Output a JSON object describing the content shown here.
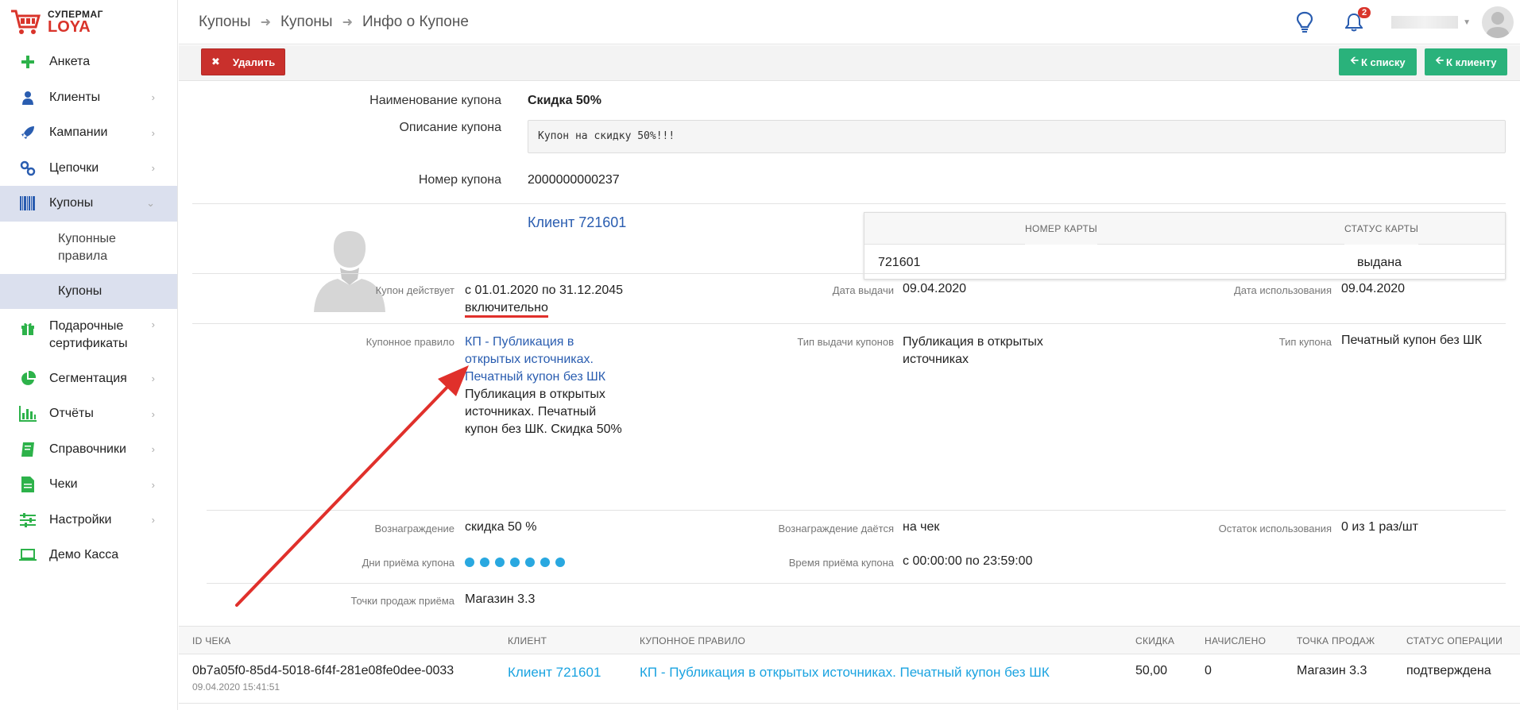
{
  "logo": {
    "top": "СУПЕРМАГ",
    "bottom": "LOYA"
  },
  "sidebar": {
    "items": [
      {
        "label": "Анкета",
        "icon": "plus-icon",
        "chevron": false
      },
      {
        "label": "Клиенты",
        "icon": "user-icon",
        "chevron": true
      },
      {
        "label": "Кампании",
        "icon": "rocket-icon",
        "chevron": true
      },
      {
        "label": "Цепочки",
        "icon": "chain-icon",
        "chevron": true
      },
      {
        "label": "Купоны",
        "icon": "barcode-icon",
        "chevron": true,
        "active": true
      },
      {
        "label": "Подарочные сертификаты",
        "icon": "gift-icon",
        "chevron": true
      },
      {
        "label": "Сегментация",
        "icon": "pie-icon",
        "chevron": true
      },
      {
        "label": "Отчёты",
        "icon": "bar-chart-icon",
        "chevron": true
      },
      {
        "label": "Справочники",
        "icon": "book-icon",
        "chevron": true
      },
      {
        "label": "Чеки",
        "icon": "receipt-icon",
        "chevron": true
      },
      {
        "label": "Настройки",
        "icon": "sliders-icon",
        "chevron": true
      },
      {
        "label": "Демо Касса",
        "icon": "laptop-icon",
        "chevron": false
      }
    ],
    "sub_items": [
      {
        "label": "Купонные правила"
      },
      {
        "label": "Купоны",
        "active": true
      }
    ]
  },
  "header": {
    "breadcrumb": [
      "Купоны",
      "Купоны",
      "Инфо о Купоне"
    ],
    "notifications_count": "2"
  },
  "toolbar": {
    "delete_label": "Удалить",
    "to_list_label": "К списку",
    "to_client_label": "К клиенту"
  },
  "coupon": {
    "name_label": "Наименование купона",
    "name_value": "Скидка 50%",
    "desc_label": "Описание купона",
    "desc_value": "Купон на скидку 50%!!!",
    "number_label": "Номер купона",
    "number_value": "2000000000237"
  },
  "client": {
    "link": "Клиент 721601",
    "cards_table": {
      "headers": [
        "НОМЕР КАРТЫ",
        "СТАТУС КАРТЫ"
      ],
      "rows": [
        [
          "721601",
          "выдана"
        ]
      ]
    }
  },
  "details": {
    "valid_label": "Купон действует",
    "valid_value_line1": "с 01.01.2020 по 31.12.2045",
    "valid_value_line2": "включительно",
    "issue_date_label": "Дата выдачи",
    "issue_date_value": "09.04.2020",
    "use_date_label": "Дата использования",
    "use_date_value": "09.04.2020",
    "rule_label": "Купонное правило",
    "rule_link_lines": [
      "КП - Публикация в",
      "открытых источниках.",
      "Печатный купон без ШК"
    ],
    "rule_desc_lines": [
      "Публикация в открытых",
      "источниках. Печатный",
      "купон без ШК. Скидка 50%"
    ],
    "issue_type_label": "Тип выдачи купонов",
    "issue_type_lines": [
      "Публикация в открытых",
      "источниках"
    ],
    "coupon_type_label": "Тип купона",
    "coupon_type_value": "Печатный купон без ШК",
    "reward_label": "Вознаграждение",
    "reward_value": "скидка 50 %",
    "reward_given_label": "Вознаграждение даётся",
    "reward_given_value": "на чек",
    "usage_left_label": "Остаток использования",
    "usage_left_value": "0 из 1 раз/шт",
    "days_label": "Дни приёма купона",
    "days_count": 7,
    "time_label": "Время приёма купона",
    "time_value": "с 00:00:00 по 23:59:00",
    "points_label": "Точки продаж приёма",
    "points_value": "Магазин 3.3"
  },
  "receipts": {
    "headers": [
      "ID ЧЕКА",
      "КЛИЕНТ",
      "КУПОННОЕ ПРАВИЛО",
      "СКИДКА",
      "НАЧИСЛЕНО",
      "ТОЧКА ПРОДАЖ",
      "СТАТУС ОПЕРАЦИИ"
    ],
    "rows": [
      {
        "id": "0b7a05f0-85d4-5018-6f4f-281e08fe0dee-0033",
        "datetime": "09.04.2020 15:41:51",
        "client": "Клиент 721601",
        "rule": "КП - Публикация в открытых источниках. Печатный купон без ШК",
        "discount": "50,00",
        "accrued": "0",
        "point": "Магазин 3.3",
        "status": "подтверждена"
      }
    ]
  },
  "colors": {
    "accent_blue": "#2a5db0",
    "link_cyan": "#1aa3e0",
    "danger": "#c9302c",
    "success": "#2ab27b",
    "sidebar_icon_green": "#2db24a",
    "annotation_red": "#e0302b"
  }
}
